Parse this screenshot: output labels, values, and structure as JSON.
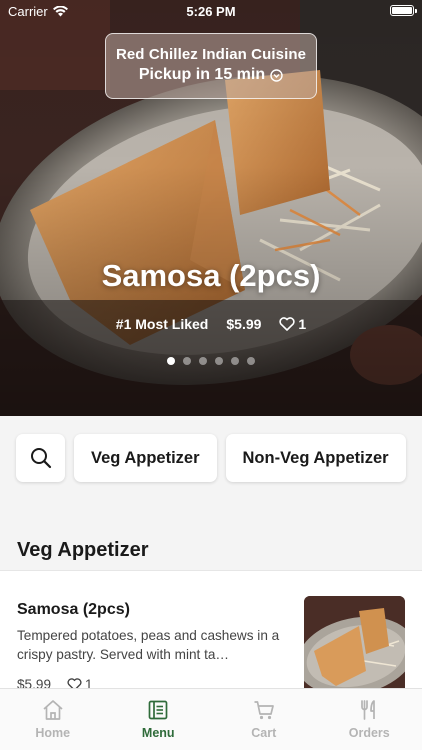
{
  "status_bar": {
    "carrier": "Carrier",
    "time": "5:26 PM"
  },
  "restaurant": {
    "name": "Red Chillez Indian Cuisine",
    "pickup": "Pickup in 15 min"
  },
  "featured": {
    "title": "Samosa (2pcs)",
    "badge": "#1 Most Liked",
    "price": "$5.99",
    "likes": "1",
    "slide_count": 6,
    "active_slide": 1
  },
  "categories": [
    "Veg Appetizer",
    "Non-Veg Appetizer"
  ],
  "section": {
    "title": "Veg Appetizer"
  },
  "menu_item": {
    "name": "Samosa (2pcs)",
    "description": "Tempered potatoes, peas and cashews in a crispy pastry. Served with mint ta…",
    "price": "$5.99",
    "likes": "1"
  },
  "tab_bar": {
    "active": "Menu",
    "tabs": [
      {
        "label": "Home",
        "icon": "home-icon"
      },
      {
        "label": "Menu",
        "icon": "menu-icon"
      },
      {
        "label": "Cart",
        "icon": "cart-icon"
      },
      {
        "label": "Orders",
        "icon": "utensils-icon"
      }
    ]
  },
  "colors": {
    "accent": "#2f6b3a",
    "inactive_tab": "#b4b4b4"
  }
}
